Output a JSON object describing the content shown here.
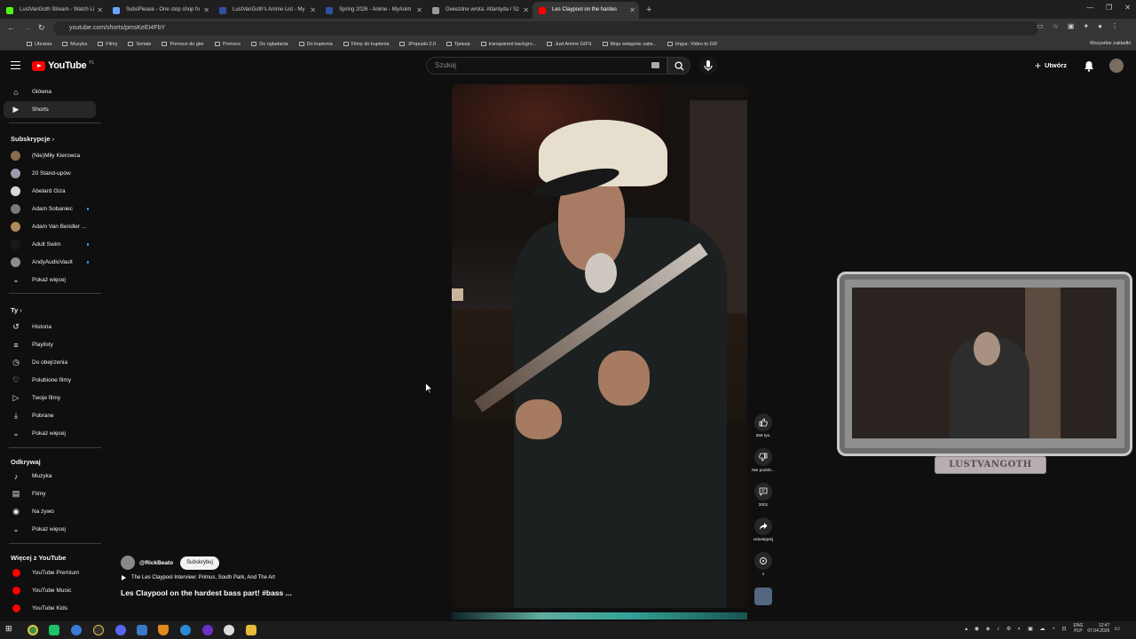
{
  "browser": {
    "tabs": [
      {
        "label": "LustVanGoth Stream - Watch Li",
        "color": "#53fc18"
      },
      {
        "label": "SubsPlease - One stop shop fo",
        "color": "#6aa5ff"
      },
      {
        "label": "LustVanGoth's Anime List - My",
        "color": "#2e51a2"
      },
      {
        "label": "Spring 2026 - Anime - MyAnim",
        "color": "#2e51a2"
      },
      {
        "label": "Gwiezdne wrota: Atlantyda / Sz",
        "color": "#9a9a9a"
      },
      {
        "label": "Les Claypool on the hardes",
        "color": "#ff0000"
      }
    ],
    "url": "youtube.com/shorts/pmsKeEI4FbY",
    "bookmarks": [
      "Ubrania",
      "Muzyka",
      "Filmy",
      "Seriale",
      "Pomoce do gier",
      "Pomoce",
      "Do ogladania",
      "Do kupienia",
      "Filmy do kupienia",
      "JPopuski 2.0",
      "Трекер",
      "transparent backgro...",
      "Just Anime GIFS",
      "Moje wstępnie zatw...",
      "Imgur: Video to GIF"
    ],
    "bookmarks_right": "Wszystkie zakładki"
  },
  "youtube": {
    "logo_text": "YouTube",
    "logo_country": "PL",
    "search_placeholder": "Szukaj",
    "create_label": "Utwórz"
  },
  "sidebar": {
    "main": [
      {
        "label": "Główna",
        "icon": "home-icon"
      },
      {
        "label": "Shorts",
        "icon": "shorts-icon",
        "active": true
      }
    ],
    "subs_heading": "Subskrypcje",
    "subs": [
      {
        "label": "(Nie)Miły Kierowca",
        "color": "#8a6a4a",
        "dot": false
      },
      {
        "label": "20 Stand-upów",
        "color": "#9a9ab0",
        "dot": false
      },
      {
        "label": "Abelard Giza",
        "color": "#d8d8d8",
        "dot": false
      },
      {
        "label": "Adam Sobaniec",
        "color": "#7a7a7a",
        "dot": true
      },
      {
        "label": "Adam Van Bendler ...",
        "color": "#b08c5c",
        "dot": false
      },
      {
        "label": "Adult Swim",
        "color": "#1a1a1a",
        "dot": true
      },
      {
        "label": "AndyAudioVault",
        "color": "#8c8c8c",
        "dot": true
      }
    ],
    "show_more": "Pokaż więcej",
    "you_heading": "Ty",
    "you": [
      {
        "label": "Historia",
        "icon": "history-icon"
      },
      {
        "label": "Playlisty",
        "icon": "playlist-icon"
      },
      {
        "label": "Do obejrzenia",
        "icon": "watch-later-icon"
      },
      {
        "label": "Polubione filmy",
        "icon": "like-icon"
      },
      {
        "label": "Twoje filmy",
        "icon": "your-videos-icon"
      },
      {
        "label": "Pobrane",
        "icon": "download-icon"
      },
      {
        "label": "Pokaż więcej",
        "icon": "chevron-down-icon"
      }
    ],
    "explore_heading": "Odkrywaj",
    "explore": [
      {
        "label": "Muzyka",
        "icon": "music-icon"
      },
      {
        "label": "Filmy",
        "icon": "film-icon"
      },
      {
        "label": "Na żywo",
        "icon": "live-icon"
      },
      {
        "label": "Pokaż więcej",
        "icon": "chevron-down-icon"
      }
    ],
    "more_heading": "Więcej z YouTube",
    "more": [
      {
        "label": "YouTube Premium"
      },
      {
        "label": "YouTube Music"
      },
      {
        "label": "YouTube Kids"
      }
    ]
  },
  "short": {
    "channel": "@RickBeato",
    "subscribe_label": "Subskrybuj",
    "related": "The Les Claypool Interview: Primus, South Park, And The Art",
    "title": "Les Claypool on the hardest bass part! #bass ...",
    "actions": {
      "likes": "259 tys.",
      "dislike": "Nie podob...",
      "comments": "3001",
      "share": "Udostępnij",
      "remix": "1"
    }
  },
  "overlay": {
    "cam_label": "LUSTVANGOTH"
  },
  "taskbar": {
    "lang_top": "ENG",
    "lang_bottom": "PLP",
    "time": "12:47",
    "date": "07.04.2026"
  }
}
